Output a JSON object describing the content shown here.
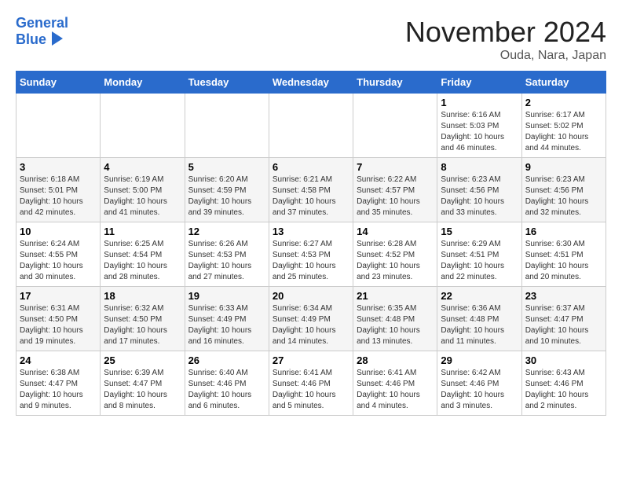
{
  "header": {
    "logo_line1": "General",
    "logo_line2": "Blue",
    "month": "November 2024",
    "location": "Ouda, Nara, Japan"
  },
  "weekdays": [
    "Sunday",
    "Monday",
    "Tuesday",
    "Wednesday",
    "Thursday",
    "Friday",
    "Saturday"
  ],
  "weeks": [
    [
      {
        "day": "",
        "info": ""
      },
      {
        "day": "",
        "info": ""
      },
      {
        "day": "",
        "info": ""
      },
      {
        "day": "",
        "info": ""
      },
      {
        "day": "",
        "info": ""
      },
      {
        "day": "1",
        "info": "Sunrise: 6:16 AM\nSunset: 5:03 PM\nDaylight: 10 hours and 46 minutes."
      },
      {
        "day": "2",
        "info": "Sunrise: 6:17 AM\nSunset: 5:02 PM\nDaylight: 10 hours and 44 minutes."
      }
    ],
    [
      {
        "day": "3",
        "info": "Sunrise: 6:18 AM\nSunset: 5:01 PM\nDaylight: 10 hours and 42 minutes."
      },
      {
        "day": "4",
        "info": "Sunrise: 6:19 AM\nSunset: 5:00 PM\nDaylight: 10 hours and 41 minutes."
      },
      {
        "day": "5",
        "info": "Sunrise: 6:20 AM\nSunset: 4:59 PM\nDaylight: 10 hours and 39 minutes."
      },
      {
        "day": "6",
        "info": "Sunrise: 6:21 AM\nSunset: 4:58 PM\nDaylight: 10 hours and 37 minutes."
      },
      {
        "day": "7",
        "info": "Sunrise: 6:22 AM\nSunset: 4:57 PM\nDaylight: 10 hours and 35 minutes."
      },
      {
        "day": "8",
        "info": "Sunrise: 6:23 AM\nSunset: 4:56 PM\nDaylight: 10 hours and 33 minutes."
      },
      {
        "day": "9",
        "info": "Sunrise: 6:23 AM\nSunset: 4:56 PM\nDaylight: 10 hours and 32 minutes."
      }
    ],
    [
      {
        "day": "10",
        "info": "Sunrise: 6:24 AM\nSunset: 4:55 PM\nDaylight: 10 hours and 30 minutes."
      },
      {
        "day": "11",
        "info": "Sunrise: 6:25 AM\nSunset: 4:54 PM\nDaylight: 10 hours and 28 minutes."
      },
      {
        "day": "12",
        "info": "Sunrise: 6:26 AM\nSunset: 4:53 PM\nDaylight: 10 hours and 27 minutes."
      },
      {
        "day": "13",
        "info": "Sunrise: 6:27 AM\nSunset: 4:53 PM\nDaylight: 10 hours and 25 minutes."
      },
      {
        "day": "14",
        "info": "Sunrise: 6:28 AM\nSunset: 4:52 PM\nDaylight: 10 hours and 23 minutes."
      },
      {
        "day": "15",
        "info": "Sunrise: 6:29 AM\nSunset: 4:51 PM\nDaylight: 10 hours and 22 minutes."
      },
      {
        "day": "16",
        "info": "Sunrise: 6:30 AM\nSunset: 4:51 PM\nDaylight: 10 hours and 20 minutes."
      }
    ],
    [
      {
        "day": "17",
        "info": "Sunrise: 6:31 AM\nSunset: 4:50 PM\nDaylight: 10 hours and 19 minutes."
      },
      {
        "day": "18",
        "info": "Sunrise: 6:32 AM\nSunset: 4:50 PM\nDaylight: 10 hours and 17 minutes."
      },
      {
        "day": "19",
        "info": "Sunrise: 6:33 AM\nSunset: 4:49 PM\nDaylight: 10 hours and 16 minutes."
      },
      {
        "day": "20",
        "info": "Sunrise: 6:34 AM\nSunset: 4:49 PM\nDaylight: 10 hours and 14 minutes."
      },
      {
        "day": "21",
        "info": "Sunrise: 6:35 AM\nSunset: 4:48 PM\nDaylight: 10 hours and 13 minutes."
      },
      {
        "day": "22",
        "info": "Sunrise: 6:36 AM\nSunset: 4:48 PM\nDaylight: 10 hours and 11 minutes."
      },
      {
        "day": "23",
        "info": "Sunrise: 6:37 AM\nSunset: 4:47 PM\nDaylight: 10 hours and 10 minutes."
      }
    ],
    [
      {
        "day": "24",
        "info": "Sunrise: 6:38 AM\nSunset: 4:47 PM\nDaylight: 10 hours and 9 minutes."
      },
      {
        "day": "25",
        "info": "Sunrise: 6:39 AM\nSunset: 4:47 PM\nDaylight: 10 hours and 8 minutes."
      },
      {
        "day": "26",
        "info": "Sunrise: 6:40 AM\nSunset: 4:46 PM\nDaylight: 10 hours and 6 minutes."
      },
      {
        "day": "27",
        "info": "Sunrise: 6:41 AM\nSunset: 4:46 PM\nDaylight: 10 hours and 5 minutes."
      },
      {
        "day": "28",
        "info": "Sunrise: 6:41 AM\nSunset: 4:46 PM\nDaylight: 10 hours and 4 minutes."
      },
      {
        "day": "29",
        "info": "Sunrise: 6:42 AM\nSunset: 4:46 PM\nDaylight: 10 hours and 3 minutes."
      },
      {
        "day": "30",
        "info": "Sunrise: 6:43 AM\nSunset: 4:46 PM\nDaylight: 10 hours and 2 minutes."
      }
    ]
  ]
}
